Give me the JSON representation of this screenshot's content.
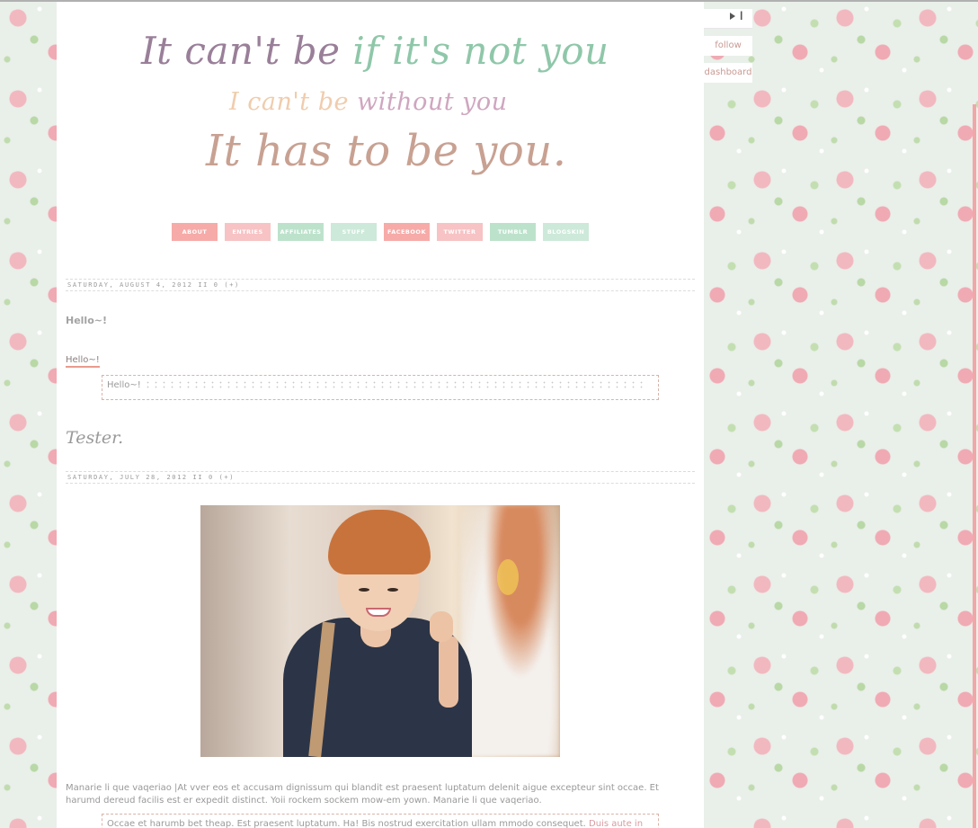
{
  "header": {
    "line1_a": "It can't be",
    "line1_b": "if it's not you",
    "line2_a": "I can't be",
    "line2_b": "without you",
    "line3": "It has to be you."
  },
  "nav": [
    {
      "label": "ABOUT",
      "color": "#f6aba8"
    },
    {
      "label": "ENTRIES",
      "color": "#f7c3c4"
    },
    {
      "label": "AFFILIATES",
      "color": "#bde2cc"
    },
    {
      "label": "STUFF",
      "color": "#cde9d9"
    },
    {
      "label": "FACEBOOK",
      "color": "#f6aba8"
    },
    {
      "label": "TWITTER",
      "color": "#f7c3c4"
    },
    {
      "label": "TUMBLR",
      "color": "#bde2cc"
    },
    {
      "label": "BLOGSKIN",
      "color": "#cde9d9"
    }
  ],
  "posts": [
    {
      "date": "SATURDAY, AUGUST 4, 2012 II 0 (+)",
      "title": "Hello~!",
      "subtitle": "Hello~!",
      "quote": "Hello~!"
    },
    {
      "date": "SATURDAY, JULY 28, 2012 II 0 (+)"
    }
  ],
  "tester": "Tester.",
  "post2_body": "Manarie li que vaqeriao |At vver eos et accusam dignissum qui blandit est praesent luptatum delenit aigue excepteur sint occae. Et harumd dereud facilis est er expedit distinct. Yoii rockem sockem mow-em yown. Manarie li que vaqeriao.",
  "post2_quote": "Occae et harumb bet theap. Est praesent luptatum. Ha! Bis nostrud exercitation ullam mmodo consequet.",
  "post2_quote_link": "Duis aute in",
  "widget": {
    "follow": "follow",
    "dashboard": "dashboard"
  }
}
